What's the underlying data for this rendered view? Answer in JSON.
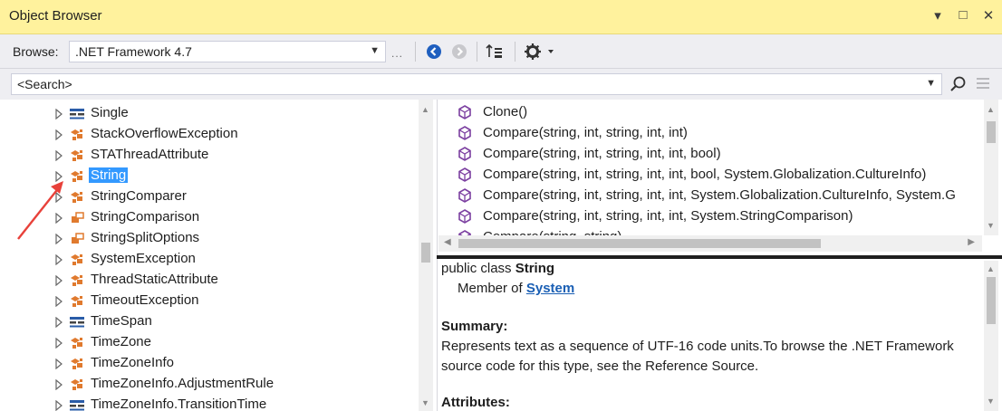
{
  "window": {
    "title": "Object Browser",
    "controls": [
      "▾",
      "□",
      "✕"
    ]
  },
  "toolbar": {
    "browse_label": "Browse:",
    "browse_value": ".NET Framework 4.7",
    "dots": "...",
    "icons": [
      "back-icon",
      "forward-icon",
      "sort-icon",
      "settings-gear-icon"
    ]
  },
  "search": {
    "placeholder": "<Search>",
    "value": "<Search>"
  },
  "tree": {
    "items": [
      {
        "label": "Single",
        "icon": "struct-icon",
        "selected": false
      },
      {
        "label": "StackOverflowException",
        "icon": "class-icon",
        "selected": false
      },
      {
        "label": "STAThreadAttribute",
        "icon": "class-icon",
        "selected": false
      },
      {
        "label": "String",
        "icon": "class-icon",
        "selected": true
      },
      {
        "label": "StringComparer",
        "icon": "class-icon",
        "selected": false
      },
      {
        "label": "StringComparison",
        "icon": "enum-icon",
        "selected": false
      },
      {
        "label": "StringSplitOptions",
        "icon": "enum-icon",
        "selected": false
      },
      {
        "label": "SystemException",
        "icon": "class-icon",
        "selected": false
      },
      {
        "label": "ThreadStaticAttribute",
        "icon": "class-icon",
        "selected": false
      },
      {
        "label": "TimeoutException",
        "icon": "class-icon",
        "selected": false
      },
      {
        "label": "TimeSpan",
        "icon": "struct-icon",
        "selected": false
      },
      {
        "label": "TimeZone",
        "icon": "class-icon",
        "selected": false
      },
      {
        "label": "TimeZoneInfo",
        "icon": "class-icon",
        "selected": false
      },
      {
        "label": "TimeZoneInfo.AdjustmentRule",
        "icon": "class-icon",
        "selected": false
      },
      {
        "label": "TimeZoneInfo.TransitionTime",
        "icon": "struct-icon",
        "selected": false
      }
    ]
  },
  "members": {
    "items": [
      "Clone()",
      "Compare(string, int, string, int, int)",
      "Compare(string, int, string, int, int, bool)",
      "Compare(string, int, string, int, int, bool, System.Globalization.CultureInfo)",
      "Compare(string, int, string, int, int, System.Globalization.CultureInfo, System.G",
      "Compare(string, int, string, int, int, System.StringComparison)",
      "Compare(string, string)"
    ]
  },
  "description": {
    "decl_prefix": "public class ",
    "decl_name": "String",
    "member_of_label": "Member of ",
    "member_of_link": "System",
    "summary_heading": "Summary:",
    "summary_line1": "Represents text as a sequence of UTF-16 code units.To browse the .NET Framework",
    "summary_line2": "source code for this type, see the Reference Source.",
    "attributes_heading": "Attributes:"
  },
  "colors": {
    "title_bar": "#fff29d",
    "selection": "#3399ff",
    "class_icon": "#e07a2e",
    "method_icon": "#7b3fa0",
    "struct_icon": "#2a5ca8",
    "annotation_arrow": "#e8413a"
  }
}
